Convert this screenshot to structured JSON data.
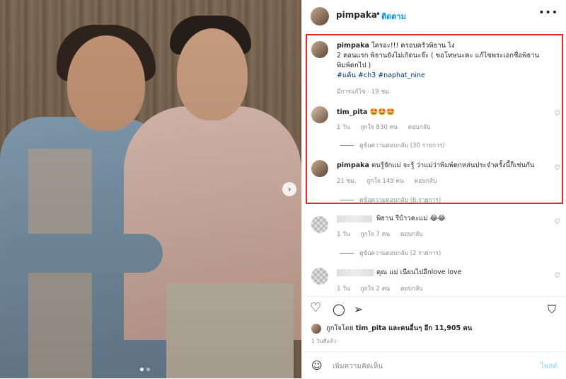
{
  "post": {
    "username": "pimpaka",
    "separator": "•",
    "follow_label": "ติดตาม",
    "more_label": "•••",
    "next_arrow": "›"
  },
  "caption": {
    "username": "pimpaka",
    "line1": "ใครอะ!!! ครอบครัวพิธาน ไง",
    "line2": "2 ตอนแรก พิธานยังไม่เกิดนะจ๊ะ ( ขอโทษนะคะ แก้ไขพระเอกชื่อพิธาน",
    "line3": "พิมพ์ตกไป )",
    "tags": "#แค้น #ch3 #naphat_nine",
    "meta": "มีการแก้ไข · 19 ชม."
  },
  "comments": [
    {
      "username": "tim_pita",
      "text": "🤩🤩🤩",
      "time": "1 วัน",
      "likes": "ถูกใจ 830 คน",
      "reply_label": "ตอบกลับ",
      "view_replies": "ดูข้อความตอบกลับ (30 รายการ)"
    },
    {
      "username": "pimpaka",
      "text": "คนรู้จักแม่ จะรู้ ว่าแม่ว่าพิมพ์ตกหล่นประจำครั้งนี้ก็เช่นกัน",
      "time": "21 ชม.",
      "likes": "ถูกใจ 149 คน",
      "reply_label": "ตอบกลับ",
      "view_replies": "ดูข้อความตอบกลับ (6 รายการ)"
    },
    {
      "username": "",
      "text": "พิธาน รีบ้าวคะแม่ 😂😂",
      "time": "1 วัน",
      "likes": "ถูกใจ 7 คน",
      "reply_label": "ตอบกลับ",
      "view_replies": "ดูข้อความตอบกลับ (2 รายการ)"
    },
    {
      "username": "",
      "text": "คุณ แม่ เนียนไปอีกlove love",
      "time": "1 วัน",
      "likes": "ถูกใจ 2 คน",
      "reply_label": "ตอบกลับ"
    }
  ],
  "heart_icon": "♡",
  "actions": {
    "like_icon": "♡",
    "comment_icon": "◯",
    "share_icon": "➢",
    "save_icon": "⛉"
  },
  "likes_summary": {
    "prefix": "ถูกใจโดย",
    "user": "tim_pita",
    "suffix": "และคนอื่นๆ อีก 11,905 คน"
  },
  "posted_time": "1 วันที่แล้ว",
  "add_comment": {
    "emoji": "☺",
    "placeholder": "เพิ่มความคิดเห็น",
    "post_label": "โพสต์"
  }
}
